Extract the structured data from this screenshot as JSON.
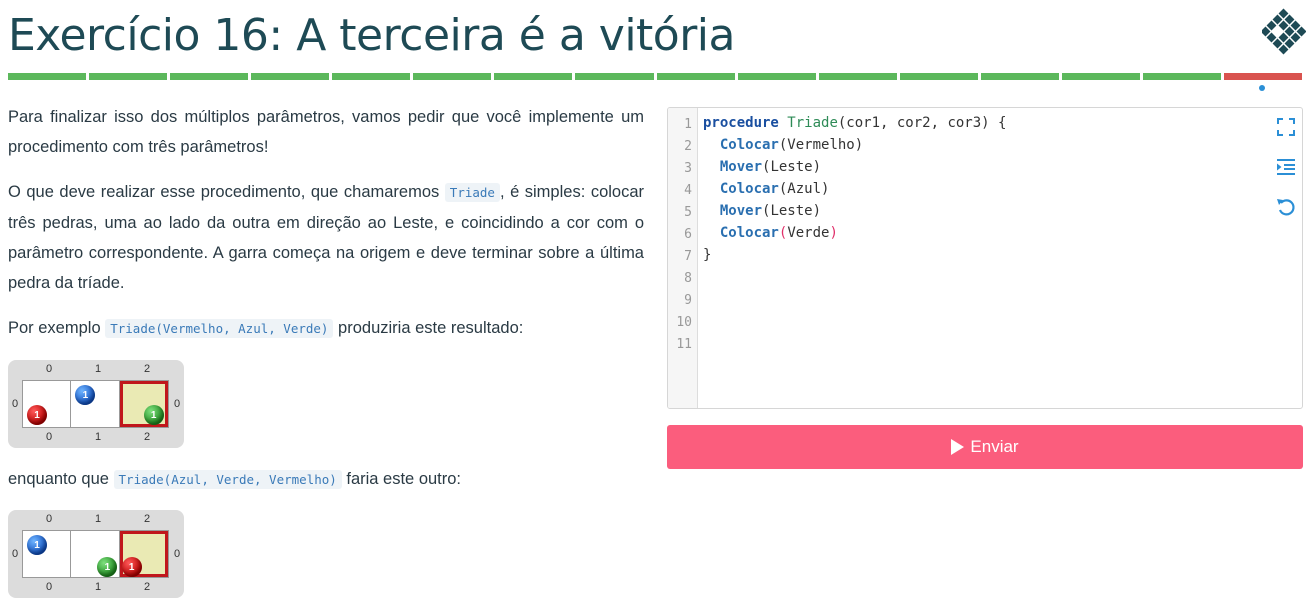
{
  "title": "Exercício 16: A terceira é a vitória",
  "progress": {
    "segments": [
      "#5cb85c",
      "#5cb85c",
      "#5cb85c",
      "#5cb85c",
      "#5cb85c",
      "#5cb85c",
      "#5cb85c",
      "#5cb85c",
      "#5cb85c",
      "#5cb85c",
      "#5cb85c",
      "#5cb85c",
      "#5cb85c",
      "#5cb85c",
      "#5cb85c",
      "#d9534f"
    ],
    "current": 16
  },
  "description": {
    "p1": "Para finalizar isso dos múltiplos parâmetros, vamos pedir que você implemente um procedimento com três parâmetros!",
    "p2_before": "O que deve realizar esse procedimento, que chamaremos ",
    "p2_code": "Triade",
    "p2_after": ", é simples: colocar três pedras, uma ao lado da outra em direção ao Leste, e coincidindo a cor com o parâmetro correspondente. A garra começa na origem e deve terminar sobre a última pedra da tríade.",
    "p3_before": "Por exemplo ",
    "p3_code": "Triade(Vermelho, Azul, Verde)",
    "p3_after": " produziria este resultado:",
    "p4_before": "enquanto que ",
    "p4_code": "Triade(Azul, Verde, Vermelho)",
    "p4_after": " faria este outro:"
  },
  "boards": [
    {
      "col_labels": [
        "0",
        "1",
        "2"
      ],
      "row_label": "0",
      "cells": [
        {
          "stone_color": "red",
          "count": "1"
        },
        {
          "stone_color": "blue",
          "count": "1"
        },
        {
          "stone_color": "green",
          "count": "1"
        }
      ],
      "head_col": 2
    },
    {
      "col_labels": [
        "0",
        "1",
        "2"
      ],
      "row_label": "0",
      "cells": [
        {
          "stone_color": "blue",
          "count": "1"
        },
        {
          "stone_color": "green",
          "count": "1"
        },
        {
          "stone_color": "red",
          "count": "1"
        }
      ],
      "head_col": 2
    }
  ],
  "editor": {
    "line_numbers": [
      "1",
      "2",
      "3",
      "4",
      "5",
      "6",
      "7",
      "8",
      "9",
      "10",
      "11"
    ],
    "code": {
      "l1_kw": "procedure",
      "l1_fn": "Triade",
      "l1_rest": "(cor1, cor2, cor3) {",
      "l2_call": "Colocar",
      "l2_rest": "(Vermelho)",
      "l3_call": "Mover",
      "l3_rest": "(Leste)",
      "l4_call": "Colocar",
      "l4_rest": "(Azul)",
      "l5_call": "Mover",
      "l5_rest": "(Leste)",
      "l6_call": "Colocar",
      "l6_open": "(",
      "l6_arg": "Verde",
      "l6_close": ")",
      "l7": "}"
    },
    "tools": [
      "fullscreen-icon",
      "indent-icon",
      "reset-icon"
    ]
  },
  "submit": {
    "label": "Enviar",
    "color": "#fb5d7d"
  }
}
